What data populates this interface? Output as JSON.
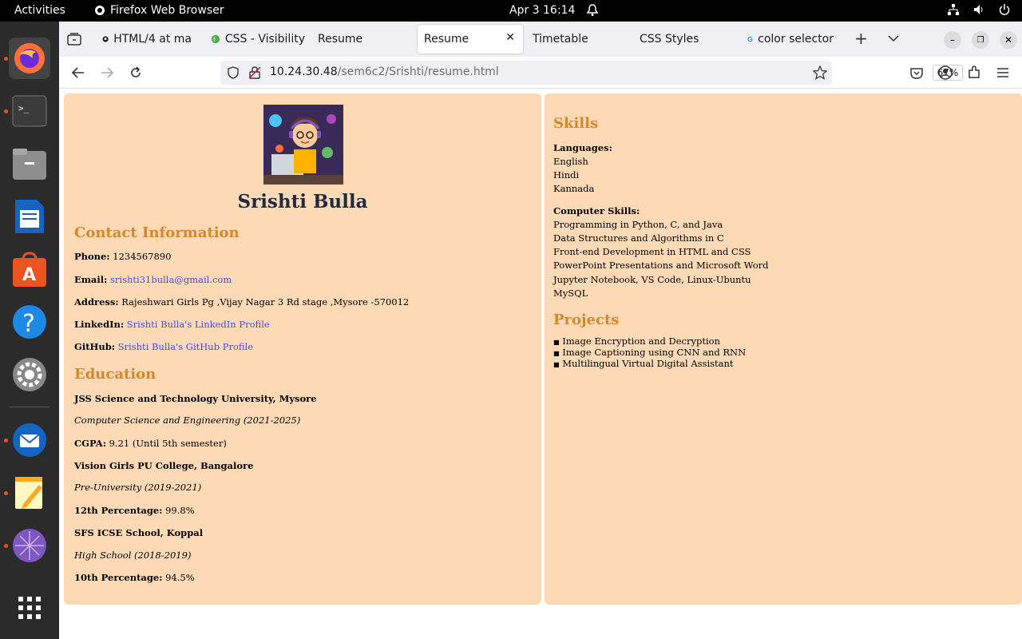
{
  "topbar": {
    "activities": "Activities",
    "app_name": "Firefox Web Browser",
    "clock": "Apr 3  16:14"
  },
  "tabs": [
    {
      "label": "HTML/4 at ma",
      "icon": "github-icon"
    },
    {
      "label": "CSS - Visibility",
      "icon": "css-icon"
    },
    {
      "label": "Resume",
      "icon": ""
    },
    {
      "label": "Resume",
      "icon": ""
    },
    {
      "label": "Timetable",
      "icon": ""
    },
    {
      "label": "CSS Styles",
      "icon": ""
    },
    {
      "label": "color selector",
      "icon": "google-icon"
    }
  ],
  "navbar": {
    "url_host": "10.24.30.48",
    "url_path": "/sem6c2/Srishti/resume.html",
    "zoom": "67%"
  },
  "resume": {
    "name": "Srishti Bulla",
    "contact_heading": "Contact Information",
    "phone_label": "Phone:",
    "phone": "1234567890",
    "email_label": "Email:",
    "email": "srishti31bulla@gmail.com",
    "address_label": "Address:",
    "address": "Rajeshwari Girls Pg ,Vijay Nagar 3 Rd stage ,Mysore -570012",
    "linkedin_label": "LinkedIn:",
    "linkedin": "Srishti Bulla's LinkedIn Profile",
    "github_label": "GitHub:",
    "github": "Srishti Bulla's GitHub Profile",
    "education_heading": "Education",
    "edu1_school": "JSS Science and Technology University, Mysore",
    "edu1_course": "Computer Science and Engineering (2021-2025)",
    "edu1_score_label": "CGPA:",
    "edu1_score": "9.21 (Until 5th semester)",
    "edu2_school": "Vision Girls PU College, Bangalore",
    "edu2_course": "Pre-University (2019-2021)",
    "edu2_score_label": "12th Percentage:",
    "edu2_score": "99.8%",
    "edu3_school": "SFS ICSE School, Koppal",
    "edu3_course": "High School (2018-2019)",
    "edu3_score_label": "10th Percentage:",
    "edu3_score": "94.5%",
    "skills_heading": "Skills",
    "languages_label": "Languages:",
    "languages": [
      "English",
      "Hindi",
      "Kannada"
    ],
    "computer_label": "Computer Skills:",
    "computer_skills": [
      "Programming in Python, C, and Java",
      "Data Structures and Algorithms in C",
      "Front-end Development in HTML and CSS",
      "PowerPoint Presentations and Microsoft Word",
      "Jupyter Notebook, VS Code, Linux-Ubuntu",
      "MySQL"
    ],
    "projects_heading": "Projects",
    "projects": [
      "Image Encryption and Decryption",
      "Image Captioning using CNN and RNN",
      "Multilingual Virtual Digital Assistant"
    ]
  },
  "colors": {
    "panel": "#fdd9b5",
    "heading": "#d4882a",
    "link": "#4a4ae0"
  }
}
